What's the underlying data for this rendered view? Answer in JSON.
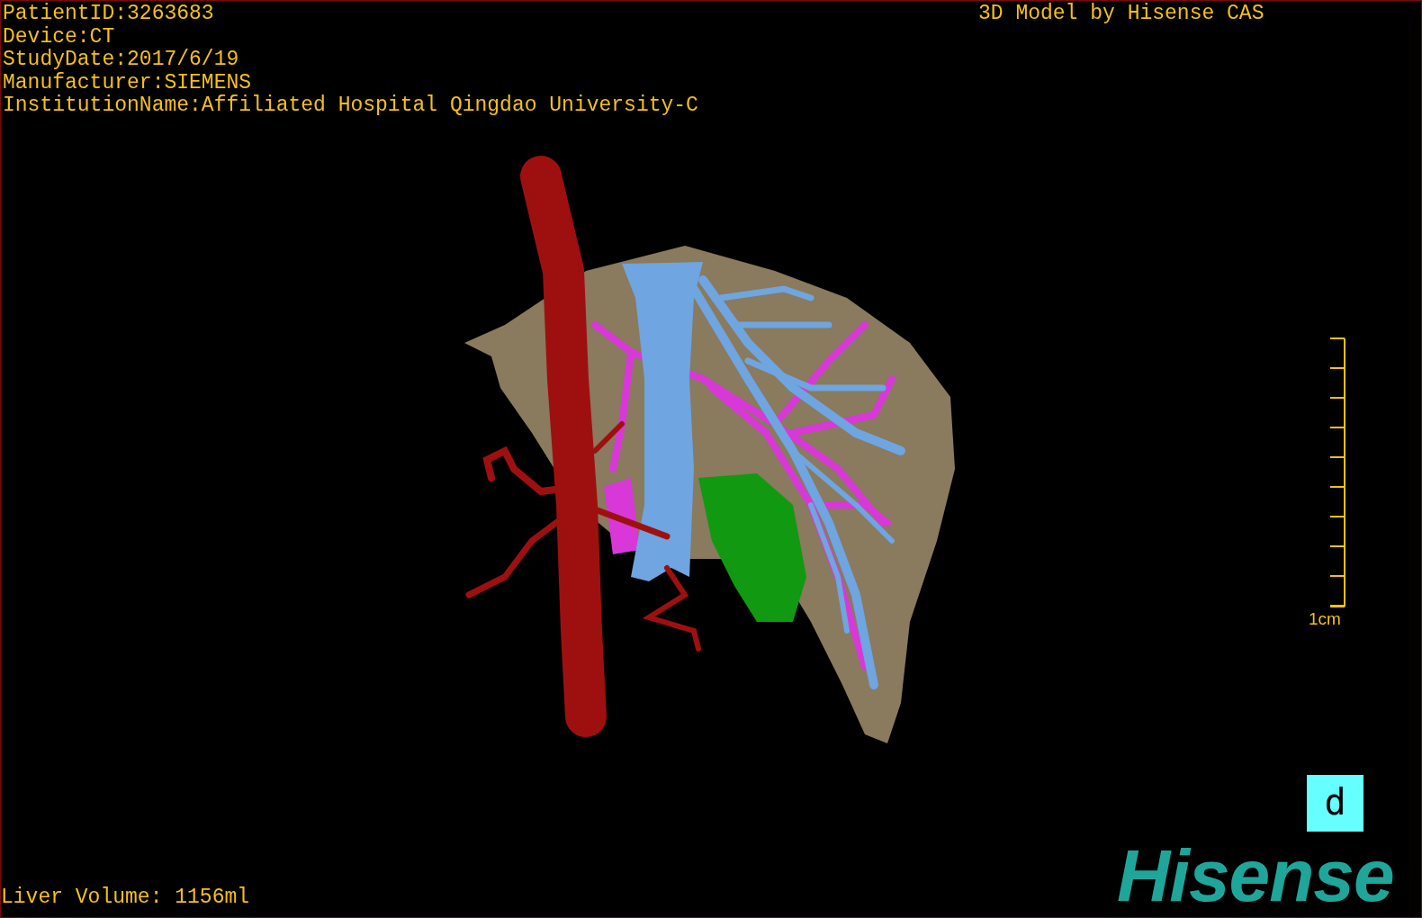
{
  "patient_info": [
    "PatientID:3263683",
    "Device:CT",
    "StudyDate:2017/6/19",
    "Manufacturer:SIEMENS",
    "InstitutionName:Affiliated Hospital Qingdao University-C"
  ],
  "model_credit": "3D Model by Hisense CAS",
  "scale_bar": {
    "label": "1cm"
  },
  "orientation_marker": "d",
  "liver_volume": "Liver Volume: 1156ml",
  "logo": "Hisense"
}
